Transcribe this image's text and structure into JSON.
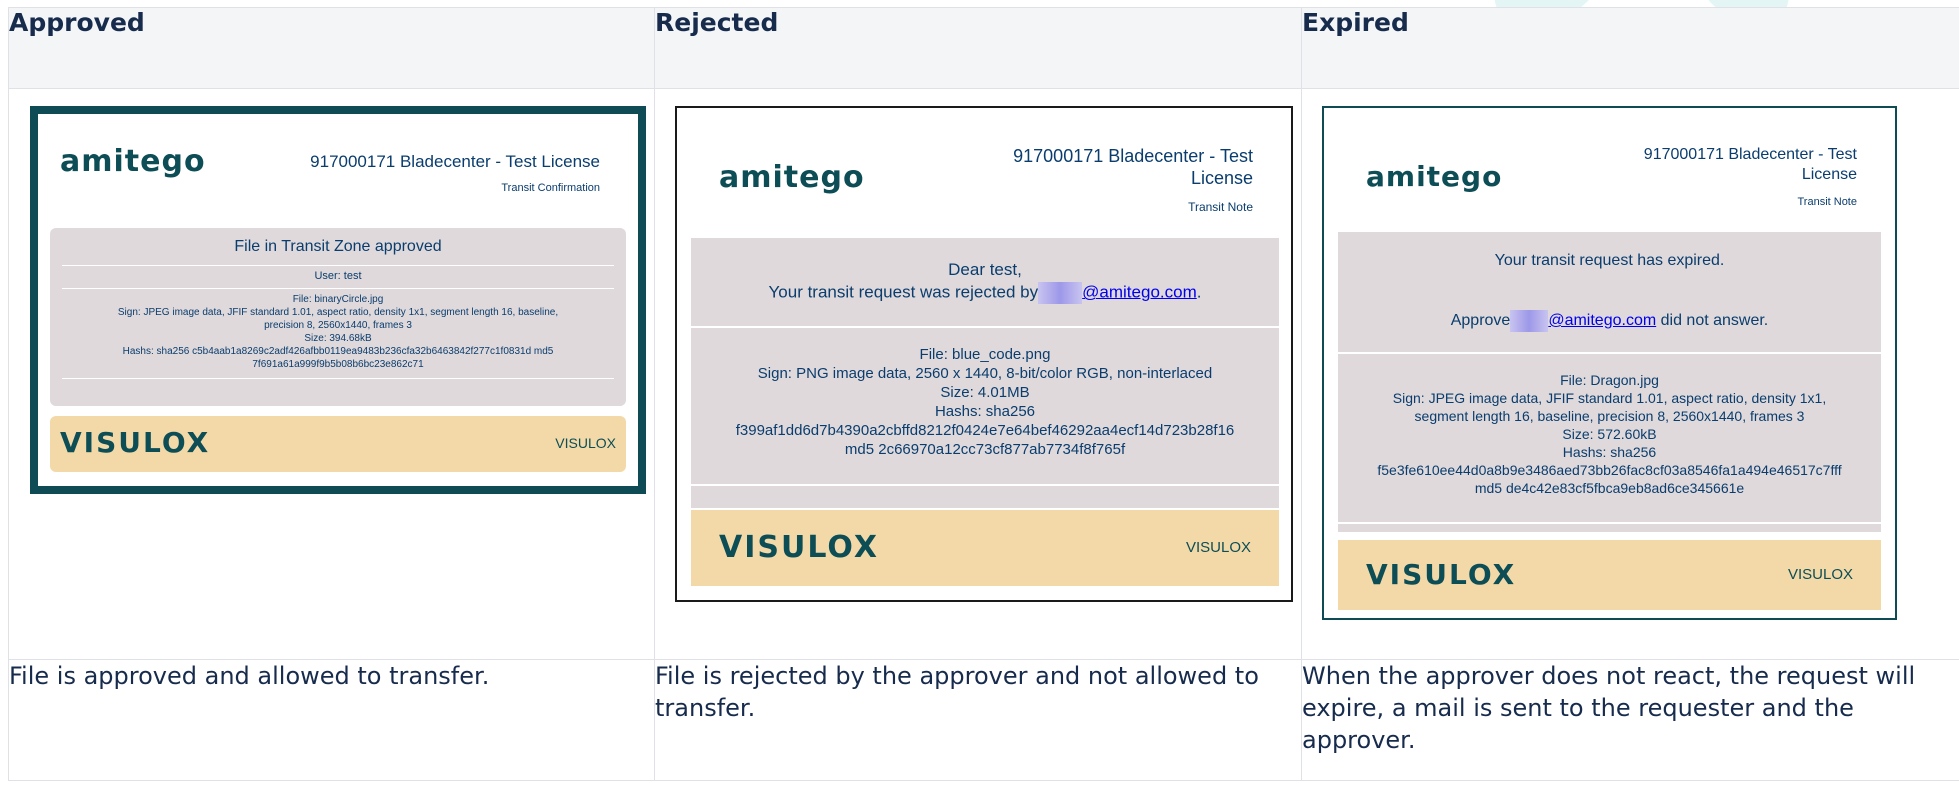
{
  "headers": [
    "Approved",
    "Rejected",
    "Expired"
  ],
  "descriptions": [
    "File is approved and allowed to transfer.",
    "File is rejected by the approver and not allowed to transfer.",
    "When the approver does not react, the request will expire, a mail is sent to the requester and the approver."
  ],
  "approved": {
    "logo": "amitego",
    "title": "917000171 Bladecenter - Test License",
    "subtitle": "Transit Confirmation",
    "status": "File in Transit Zone approved",
    "user": "User: test",
    "file": "File: binaryCircle.jpg",
    "sign1": "Sign: JPEG image data, JFIF standard 1.01, aspect ratio, density 1x1, segment length 16, baseline,",
    "sign2": "precision 8, 2560x1440, frames 3",
    "size": "Size: 394.68kB",
    "hash1": "Hashs: sha256 c5b4aab1a8269c2adf426afbb0119ea9483b236cfa32b6463842f277c1f0831d md5",
    "hash2": "7f691a61a999f9b5b08b6bc23e862c71",
    "footer_logo": "VISULOX",
    "footer_text": "VISULOX"
  },
  "rejected": {
    "logo": "amitego",
    "title1": "917000171 Bladecenter - Test",
    "title2": "License",
    "subtitle": "Transit Note",
    "greeting": "Dear test,",
    "msg_prefix": "Your transit request was rejected by",
    "msg_link": "@amitego.com",
    "msg_suffix": ".",
    "file": "File: blue_code.png",
    "sign": "Sign: PNG image data, 2560 x 1440, 8-bit/color RGB, non-interlaced",
    "size": "Size: 4.01MB",
    "hash_label": "Hashs: sha256",
    "hash1": "f399af1dd6d7b4390a2cbffd8212f0424e7e64bef46292aa4ecf14d723b28f16",
    "hash2": "md5 2c66970a12cc73cf877ab7734f8f765f",
    "footer_logo": "VISULOX",
    "footer_text": "VISULOX"
  },
  "expired": {
    "logo": "amitego",
    "title1": "917000171 Bladecenter - Test",
    "title2": "License",
    "subtitle": "Transit Note",
    "status": "Your transit request has expired.",
    "approve_prefix": "Approve",
    "approve_link": "@amitego.com",
    "approve_suffix": "did not answer.",
    "file": "File: Dragon.jpg",
    "sign1": "Sign: JPEG image data, JFIF standard 1.01, aspect ratio, density 1x1,",
    "sign2": "segment length 16, baseline, precision 8, 2560x1440, frames 3",
    "size": "Size: 572.60kB",
    "hash_label": "Hashs: sha256",
    "hash1": "f5e3fe610ee44d0a8b9e3486aed73bb26fac8cf03a8546fa1a494e46517c7fff",
    "hash2": "md5 de4c42e83cf5fbca9eb8ad6ce345661e",
    "footer_logo": "VISULOX",
    "footer_text": "VISULOX"
  },
  "colors": {
    "brand_teal": "#0c4d56",
    "panel_gray": "#dfd9db",
    "footer_sand": "#f3d9a7",
    "link_blue": "#0000ee"
  }
}
